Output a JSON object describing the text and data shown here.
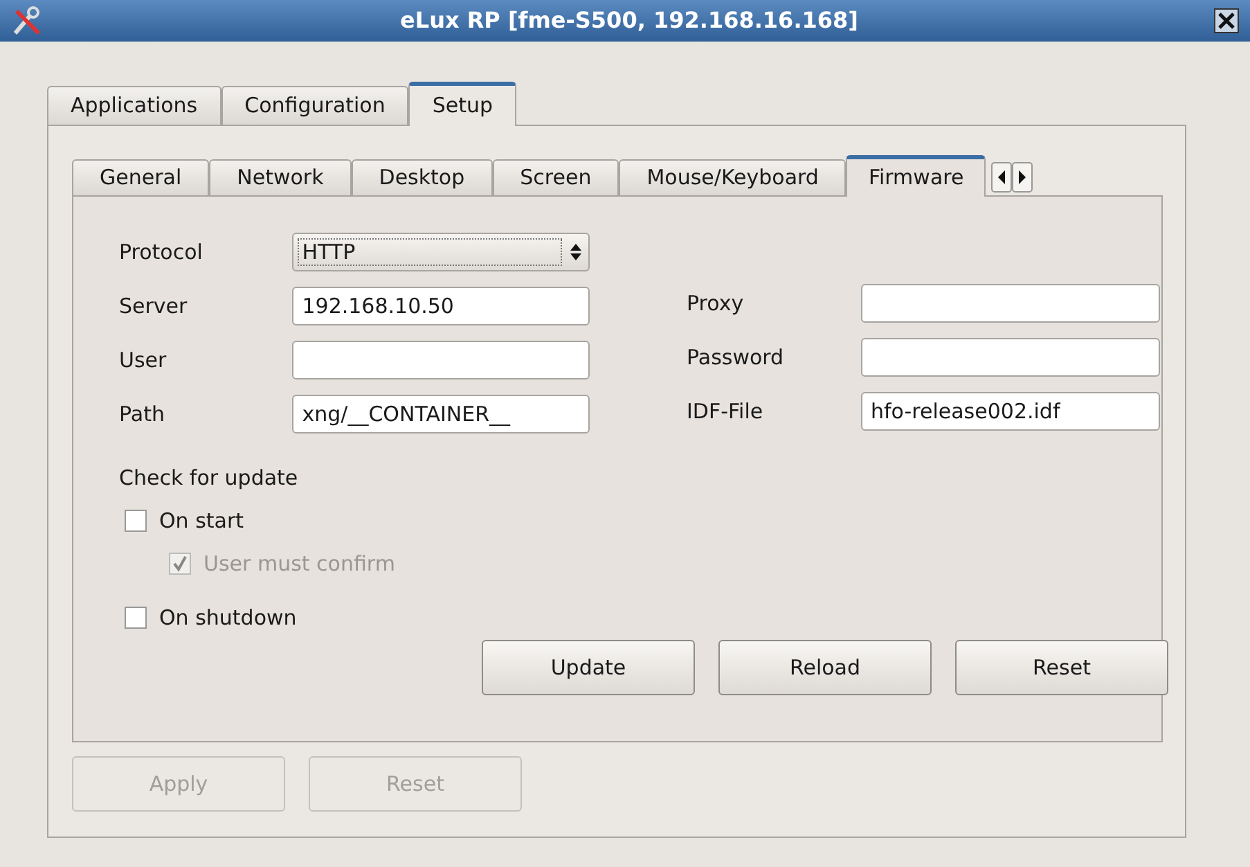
{
  "window": {
    "title": "eLux RP [fme-S500, 192.168.16.168]"
  },
  "tabs": [
    {
      "label": "Applications",
      "selected": false
    },
    {
      "label": "Configuration",
      "selected": false
    },
    {
      "label": "Setup",
      "selected": true
    }
  ],
  "subtabs": [
    {
      "label": "General",
      "selected": false
    },
    {
      "label": "Network",
      "selected": false
    },
    {
      "label": "Desktop",
      "selected": false
    },
    {
      "label": "Screen",
      "selected": false
    },
    {
      "label": "Mouse/Keyboard",
      "selected": false
    },
    {
      "label": "Firmware",
      "selected": true
    }
  ],
  "protocol": {
    "label": "Protocol",
    "value": "HTTP"
  },
  "left_fields": [
    {
      "label": "Server",
      "value": "192.168.10.50"
    },
    {
      "label": "User"
    },
    {
      "label": "Path",
      "value": "xng/__CONTAINER__"
    }
  ],
  "right_fields": [
    {
      "label": "Proxy"
    },
    {
      "label": "Password"
    },
    {
      "label": "IDF-File",
      "value": "hfo-release002.idf"
    }
  ],
  "check_heading": "Check for update",
  "checks": [
    {
      "label": "On start",
      "checked": false,
      "disabled": false,
      "indented": false
    },
    {
      "label": "User must confirm",
      "checked": true,
      "disabled": true,
      "indented": true
    },
    {
      "label": "On shutdown",
      "checked": false,
      "disabled": false,
      "indented": false
    }
  ],
  "actions": [
    {
      "label": "Update",
      "disabled": false
    },
    {
      "label": "Reload",
      "disabled": false
    },
    {
      "label": "Reset",
      "disabled": false
    }
  ],
  "bottom_buttons": [
    {
      "label": "Apply",
      "disabled": true
    },
    {
      "label": "Reset",
      "disabled": true
    }
  ]
}
